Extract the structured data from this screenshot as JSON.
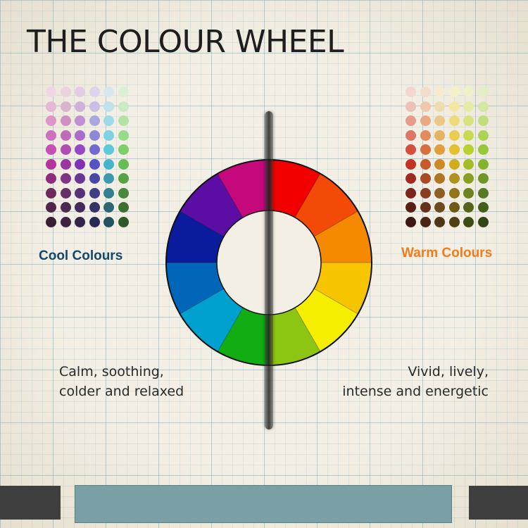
{
  "title": "THE COLOUR WHEEL",
  "cool": {
    "label": "Cool Colours",
    "label_color": "#14466e",
    "description_line1": "Calm, soothing,",
    "description_line2": "colder and relaxed",
    "swatch_columns": [
      [
        "#f0d6e2",
        "#e5b9d3",
        "#dc97c8",
        "#cf70bd",
        "#c64fb3",
        "#b6329f",
        "#8f2b7c",
        "#6d2a5f",
        "#4e2648",
        "#3a1d37"
      ],
      [
        "#ead2de",
        "#dcb3cd",
        "#cf90c2",
        "#c06bba",
        "#b14db0",
        "#9b36a0",
        "#7f3383",
        "#653066",
        "#4e2a4f",
        "#3d2340"
      ],
      [
        "#e2cde2",
        "#d2b1d8",
        "#c090d4",
        "#ab6bcd",
        "#9748c6",
        "#7f33b4",
        "#6b3495",
        "#573277",
        "#432c5c",
        "#342449"
      ],
      [
        "#dcd4ec",
        "#c8bfe6",
        "#aba5e0",
        "#8d88d9",
        "#6f6bd2",
        "#5552c5",
        "#4747a6",
        "#3f3d86",
        "#34336b",
        "#2a2956"
      ],
      [
        "#d6e8ee",
        "#bfe2ec",
        "#9fdae8",
        "#7ed2e3",
        "#5cc8dd",
        "#43b5cd",
        "#3c9aaf",
        "#357f91",
        "#2d6676",
        "#24515f"
      ],
      [
        "#dcefd6",
        "#c9ebc2",
        "#b1e3a6",
        "#98da8a",
        "#7ece6c",
        "#66bd53",
        "#55a345",
        "#48893b",
        "#3b7032",
        "#2f5a29"
      ]
    ]
  },
  "warm": {
    "label": "Warm Colours",
    "label_color": "#f07d1c",
    "description_line1": "Vivid, lively,",
    "description_line2": "intense and energetic",
    "swatch_columns": [
      [
        "#f3d6d0",
        "#eec0b7",
        "#e79b8d",
        "#df7564",
        "#d64f3c",
        "#c43224",
        "#9f2a1f",
        "#7c251c",
        "#5a1e17",
        "#3f1712"
      ],
      [
        "#f3dcca",
        "#efc7ae",
        "#e9a985",
        "#e28b5e",
        "#da6e3c",
        "#c9582a",
        "#a84a25",
        "#873d20",
        "#66311b",
        "#492516"
      ],
      [
        "#f4ead0",
        "#f0dcb1",
        "#ebc888",
        "#e5b460",
        "#df9f3c",
        "#cf8a28",
        "#af7424",
        "#8d5f20",
        "#6b4a1b",
        "#4d3716"
      ],
      [
        "#f5f0c8",
        "#f2e7a4",
        "#eedb78",
        "#e9ce4d",
        "#e3c02c",
        "#d1ac1f",
        "#b0911d",
        "#8e751a",
        "#6c5a16",
        "#4e4112"
      ],
      [
        "#eef1c8",
        "#e5eca6",
        "#d8e47b",
        "#c9db52",
        "#b9d031",
        "#a3bd26",
        "#899f22",
        "#6f821e",
        "#56651a",
        "#3f4b15"
      ],
      [
        "#e2efc4",
        "#d2e8a4",
        "#bfdf7d",
        "#abd457",
        "#97c839",
        "#82b42d",
        "#6d9728",
        "#587a22",
        "#445e1c",
        "#324516"
      ]
    ]
  },
  "wheel": {
    "segments": [
      {
        "name": "red",
        "color": "#f20000"
      },
      {
        "name": "red-orange",
        "color": "#f44a08"
      },
      {
        "name": "orange",
        "color": "#f58a00"
      },
      {
        "name": "yellow-orange",
        "color": "#f6c400"
      },
      {
        "name": "yellow",
        "color": "#f6ee00"
      },
      {
        "name": "yellow-green",
        "color": "#8cc512"
      },
      {
        "name": "green",
        "color": "#12ad12"
      },
      {
        "name": "blue-green",
        "color": "#00a1cf"
      },
      {
        "name": "blue",
        "color": "#0067b8"
      },
      {
        "name": "blue-violet",
        "color": "#0a1c9c"
      },
      {
        "name": "violet",
        "color": "#5c0da3"
      },
      {
        "name": "red-violet",
        "color": "#c5087c"
      }
    ],
    "outline_color": "#111111"
  }
}
